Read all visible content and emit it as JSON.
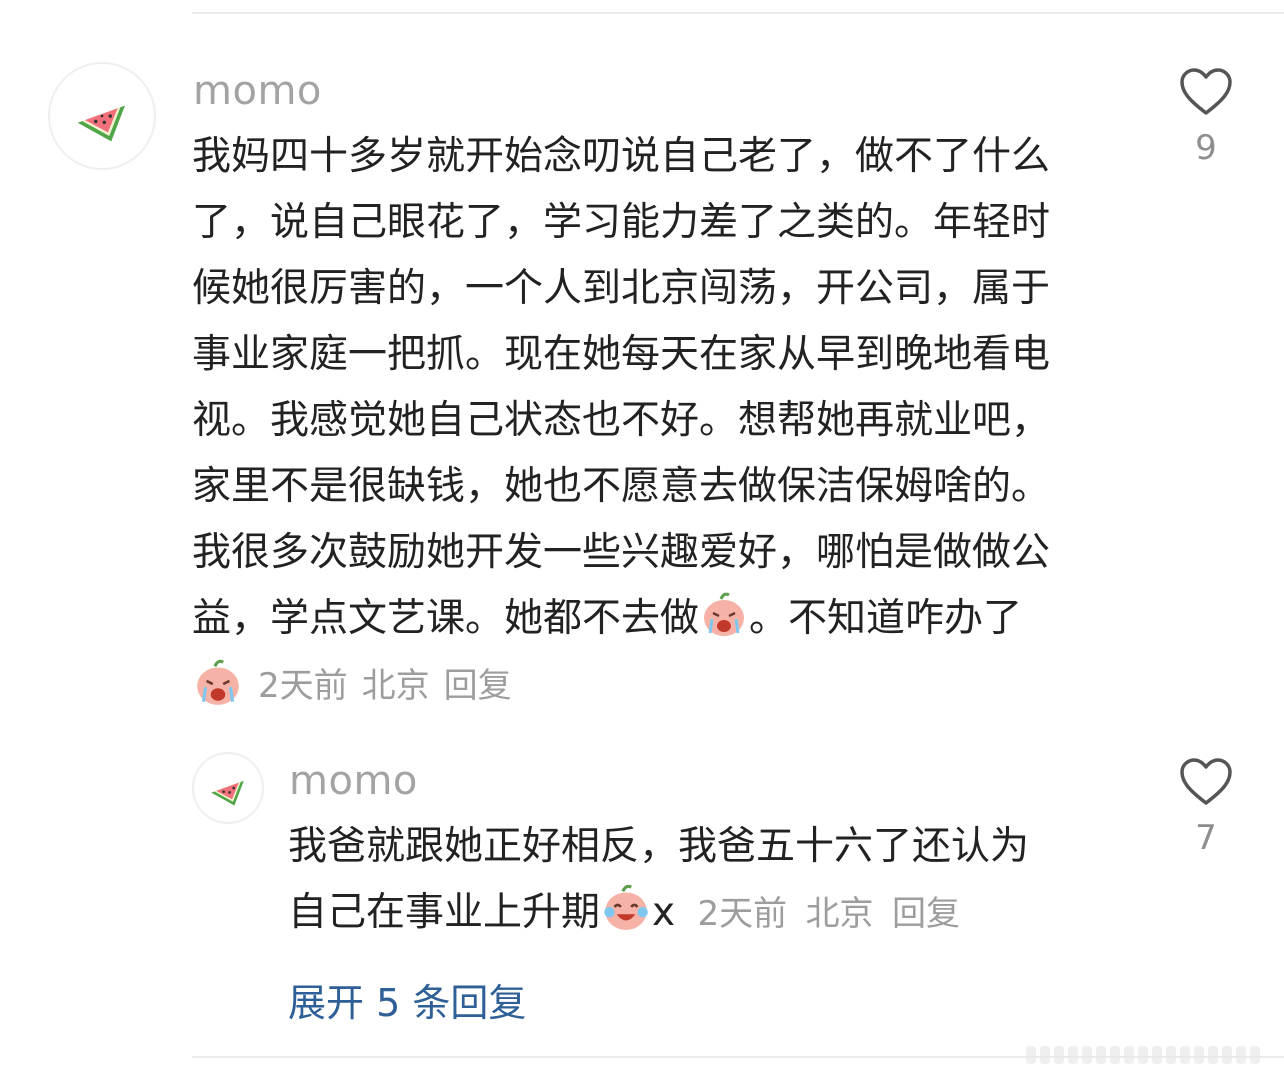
{
  "colors": {
    "username": "#a3a3a3",
    "text": "#222222",
    "meta": "#9d9d9d",
    "link": "#2e5f96",
    "divider": "#ececec"
  },
  "comment": {
    "username": "momo",
    "avatar_icon": "watermelon-icon",
    "lines": [
      "我妈四十多岁就开始念叨说自己老了，做不了什么",
      "了，说自己眼花了，学习能力差了之类的。年轻时",
      "候她很厉害的，一个人到北京闯荡，开公司，属于",
      "事业家庭一把抓。现在她每天在家从早到晚地看电",
      "视。我感觉她自己状态也不好。想帮她再就业吧，",
      "家里不是很缺钱，她也不愿意去做保洁保姆啥的。",
      "我很多次鼓励她开发一些兴趣爱好，哪怕是做做公"
    ],
    "last_line_before_emoji": "益，学点文艺课。她都不去做",
    "last_line_after_emoji": "。不知道咋办了",
    "inline_emoji": "crying-peach-emoji",
    "time": "2天前",
    "location": "北京",
    "reply_label": "回复",
    "like_icon": "heart-outline-icon",
    "likes": "9"
  },
  "reply": {
    "username": "momo",
    "avatar_icon": "watermelon-icon",
    "line1": "我爸就跟她正好相反，我爸五十六了还认为",
    "line2": "自己在事业上升期",
    "inline_emoji": "laughing-crying-peach-emoji",
    "line2_suffix": "x",
    "time": "2天前",
    "location": "北京",
    "reply_label": "回复",
    "like_icon": "heart-outline-icon",
    "likes": "7"
  },
  "expand_replies": "展开 5 条回复"
}
